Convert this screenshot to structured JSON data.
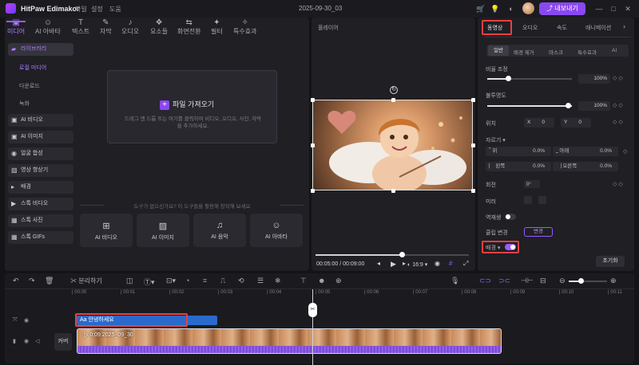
{
  "app": {
    "title": "HitPaw Edimakor",
    "menus": [
      "파일",
      "설정",
      "도움"
    ],
    "project": "2025-09-30_03",
    "export_label": "내보내기"
  },
  "top_tabs": [
    {
      "label": "미디어",
      "icon": "media-icon"
    },
    {
      "label": "AI 아바타",
      "icon": "avatar-icon"
    },
    {
      "label": "텍스트",
      "icon": "text-icon"
    },
    {
      "label": "자막",
      "icon": "subtitle-icon"
    },
    {
      "label": "오디오",
      "icon": "audio-icon"
    },
    {
      "label": "요소들",
      "icon": "elements-icon"
    },
    {
      "label": "화면전환",
      "icon": "transition-icon"
    },
    {
      "label": "필터",
      "icon": "filter-icon"
    },
    {
      "label": "특수효과",
      "icon": "effects-icon"
    }
  ],
  "sidebar": {
    "library": "라이브러리",
    "sub": [
      "로컬 미디어",
      "다운로드",
      "녹화"
    ],
    "items": [
      "AI 비디오",
      "AI 이미지",
      "얼굴 합성",
      "영상 향상기",
      "배경",
      "스톡 비디오",
      "스톡 사진",
      "스톡 GIFs"
    ]
  },
  "media": {
    "import_label": "파일 가져오기",
    "import_desc": "드래그 앤 드롭 또는 여기를 클릭하여 비디오, 오디오, 사진, 자막을 추가하세요.",
    "hint": "도구가 없으신가요? 이 도구들을 활용해 창작해 보세요",
    "tools": [
      "AI 비디오",
      "AI 이미지",
      "AI 음악",
      "AI 아바타"
    ]
  },
  "player": {
    "title": "플레이어",
    "time": "00:05:00 / 00:09:00",
    "ratio": "16:9",
    "progress": 0.56
  },
  "right": {
    "tabs": [
      "동영상",
      "오디오",
      "속도",
      "애니메이션"
    ],
    "subtabs": [
      "일반",
      "배경 제거",
      "마스크",
      "특수효과",
      "AI"
    ],
    "scale_label": "비율 조정",
    "scale_value": "100%",
    "opacity_label": "불투명도",
    "opacity_value": "100%",
    "position_label": "위치",
    "x_label": "X",
    "x_value": "0",
    "y_label": "Y",
    "y_value": "0",
    "crop_label": "자르기",
    "crop": [
      {
        "label": "위",
        "value": "0.0%"
      },
      {
        "label": "아래",
        "value": "0.0%"
      },
      {
        "label": "왼쪽",
        "value": "0.0%"
      },
      {
        "label": "오른쪽",
        "value": "0.0%"
      }
    ],
    "rotate_label": "회전",
    "rotate_value": "0°",
    "mirror_label": "미러",
    "reverse_label": "역재생",
    "clip_change_label": "클립 변경",
    "clip_change_btn": "변경",
    "bg_label": "배경",
    "reset_label": "초기화"
  },
  "timeline": {
    "split_label": "분리하기",
    "ticks": [
      "00:00",
      "00:01",
      "00:02",
      "00:03",
      "00:04",
      "00:05",
      "00:06",
      "00:07",
      "00:08",
      "00:09",
      "00:10",
      "00:11"
    ],
    "text_clip": "Aa 안녕하세요",
    "video_clip": "0:09  2025_09_30",
    "cover_label": "커버"
  },
  "colors": {
    "accent": "#9a5cff",
    "highlight": "#e84040",
    "text_clip": "#2a6acb"
  }
}
